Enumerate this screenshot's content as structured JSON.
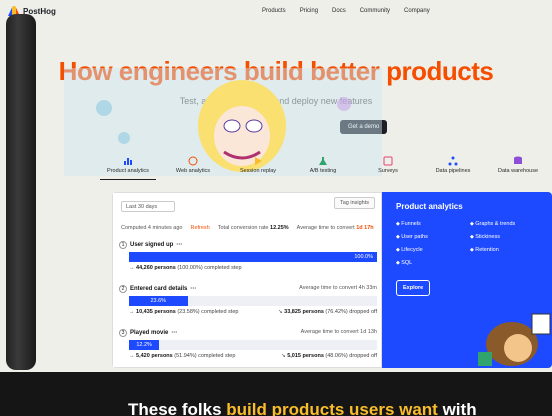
{
  "brand": {
    "name": "PostHog"
  },
  "nav": {
    "links": [
      "Products",
      "Pricing",
      "Docs",
      "Community",
      "Company"
    ]
  },
  "hero": {
    "title": "How engineers build better products",
    "subtitle": "Test, analyze, observe, and deploy new features",
    "cta": "Get a demo"
  },
  "product_tabs": [
    "Product analytics",
    "Web analytics",
    "Session replay",
    "A/B testing",
    "Surveys",
    "Data pipelines",
    "Data warehouse"
  ],
  "funnel": {
    "range_select": "Last 30 days",
    "export_button": "Tag insights",
    "computed": "Computed 4 minutes ago",
    "refresh": "Refresh",
    "conversion_label": "Total conversion rate",
    "conversion_value": "12.25%",
    "avg_time_label": "Average time to convert",
    "avg_time_value": "1d 17h",
    "steps": [
      {
        "num": "1",
        "name": "User signed up",
        "pct_label": "100.0%",
        "pct": 100,
        "completed": "44,260 persons",
        "completed_note": "(100.00%) completed step",
        "avg": "",
        "dropped": "",
        "dropped_note": ""
      },
      {
        "num": "2",
        "name": "Entered card details",
        "pct_label": "23.6%",
        "pct": 23.6,
        "completed": "10,435 persons",
        "completed_note": "(23.58%) completed step",
        "avg": "Average time to convert 4h 33m",
        "dropped": "33,825 persons",
        "dropped_note": "(76.42%) dropped off"
      },
      {
        "num": "3",
        "name": "Played movie",
        "pct_label": "12.2%",
        "pct": 12.2,
        "completed": "5,420 persons",
        "completed_note": "(51.94%) completed step",
        "avg": "Average time to convert 1d 13h",
        "dropped": "5,015 persons",
        "dropped_note": "(48.06%) dropped off"
      }
    ]
  },
  "product_panel": {
    "title": "Product analytics",
    "features": [
      "Funnels",
      "Graphs & trends",
      "User paths",
      "Stickiness",
      "Lifecycle",
      "Retention",
      "SQL"
    ],
    "explore": "Explore"
  },
  "footer_banner": {
    "part1": "These folks ",
    "highlight": "build products users want",
    "part2": " with"
  },
  "colors": {
    "accent": "#1d4aff",
    "orange": "#f54e00",
    "yellow": "#f9bd2b"
  }
}
